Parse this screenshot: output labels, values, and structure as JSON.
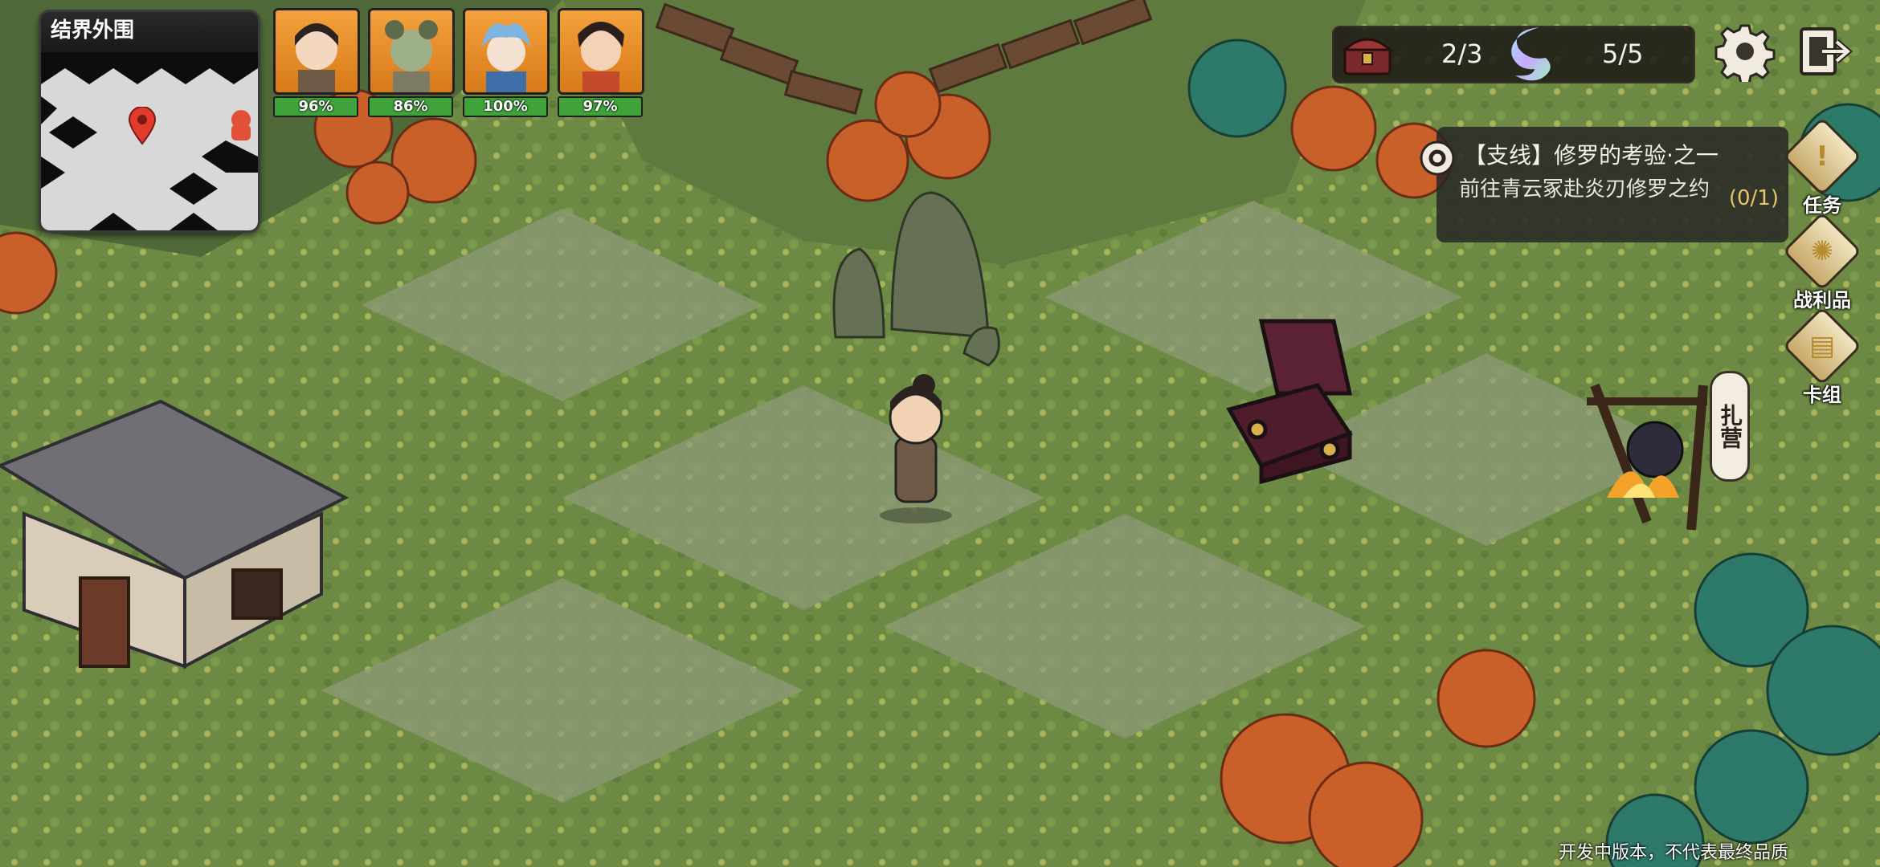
{
  "minimap": {
    "title": "结界外围"
  },
  "party": [
    {
      "name_icon": "hero-portrait-1",
      "hp": "96%"
    },
    {
      "name_icon": "hero-portrait-2",
      "hp": "86%"
    },
    {
      "name_icon": "hero-portrait-3",
      "hp": "100%"
    },
    {
      "name_icon": "hero-portrait-4",
      "hp": "97%"
    }
  ],
  "resources": {
    "chest_count": "2/3",
    "spirit_count": "5/5"
  },
  "quest": {
    "title": "【支线】修罗的考验·之一",
    "description": "前往青云冢赴炎刃修罗之约",
    "progress": "(0/1)"
  },
  "side_menu": {
    "tasks": "任务",
    "loot": "战利品",
    "deck": "卡组"
  },
  "camp_label": "扎营",
  "watermark": "开发中版本，不代表最终品质",
  "colors": {
    "hp_green": "#3fa23a",
    "portrait_bg": "#e48a25",
    "quest_accent": "#e8c46a"
  }
}
